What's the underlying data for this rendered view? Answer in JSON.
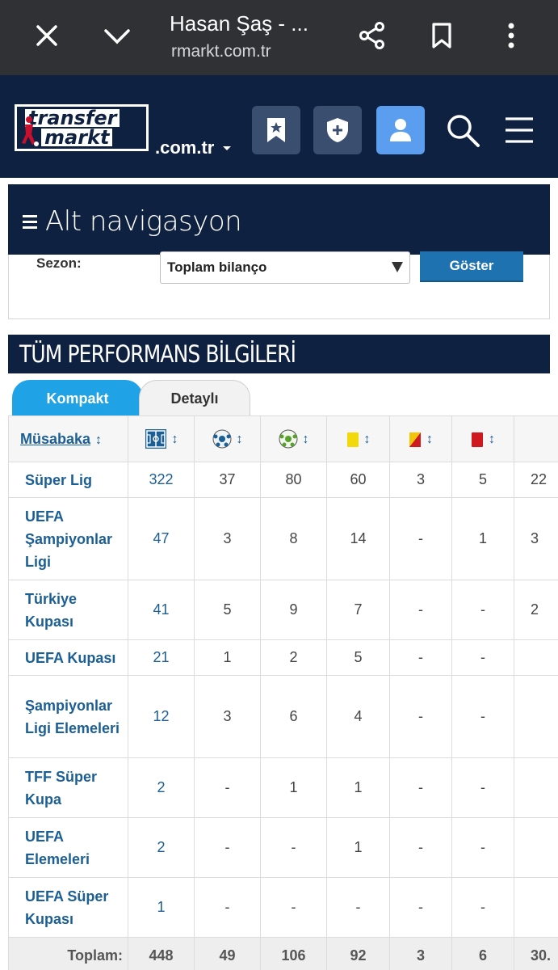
{
  "browser": {
    "title": "Hasan Şaş - ...",
    "url": "rmarkt.com.tr"
  },
  "site": {
    "logo_line1": "transfer",
    "logo_line2": "markt",
    "domain": ".com.tr"
  },
  "subnav": {
    "title": "Alt navigasyon",
    "season_label": "Sezon:",
    "season_value": "Toplam bilanço",
    "show_button": "Göster"
  },
  "performance": {
    "title": "TÜM PERFORMANS BİLGİLERİ",
    "tabs": [
      "Kompakt",
      "Detaylı"
    ],
    "header": {
      "competition": "Müsabaka",
      "sort_symbol": "↕"
    },
    "rows": [
      {
        "competition": "Süper Lig",
        "apps": "322",
        "goals": "37",
        "assists": "80",
        "yellow": "60",
        "second_yellow": "3",
        "red": "5",
        "minutes": "22"
      },
      {
        "competition": "UEFA Şampiyonlar Ligi",
        "apps": "47",
        "goals": "3",
        "assists": "8",
        "yellow": "14",
        "second_yellow": "-",
        "red": "1",
        "minutes": "3"
      },
      {
        "competition": "Türkiye Kupası",
        "apps": "41",
        "goals": "5",
        "assists": "9",
        "yellow": "7",
        "second_yellow": "-",
        "red": "-",
        "minutes": "2"
      },
      {
        "competition": "UEFA Kupası",
        "apps": "21",
        "goals": "1",
        "assists": "2",
        "yellow": "5",
        "second_yellow": "-",
        "red": "-",
        "minutes": ""
      },
      {
        "competition": "Şampiyonlar Ligi Elemeleri",
        "apps": "12",
        "goals": "3",
        "assists": "6",
        "yellow": "4",
        "second_yellow": "-",
        "red": "-",
        "minutes": ""
      },
      {
        "competition": "TFF Süper Kupa",
        "apps": "2",
        "goals": "-",
        "assists": "1",
        "yellow": "1",
        "second_yellow": "-",
        "red": "-",
        "minutes": ""
      },
      {
        "competition": "UEFA Elemeleri",
        "apps": "2",
        "goals": "-",
        "assists": "-",
        "yellow": "1",
        "second_yellow": "-",
        "red": "-",
        "minutes": ""
      },
      {
        "competition": "UEFA Süper Kupası",
        "apps": "1",
        "goals": "-",
        "assists": "-",
        "yellow": "-",
        "second_yellow": "-",
        "red": "-",
        "minutes": ""
      }
    ],
    "total": {
      "label": "Toplam:",
      "apps": "448",
      "goals": "49",
      "assists": "106",
      "yellow": "92",
      "second_yellow": "3",
      "red": "6",
      "minutes": "30."
    }
  },
  "colors": {
    "navy": "#0f2141",
    "link": "#1c5f95",
    "tab_active": "#1fa2e6",
    "button": "#1e72b0"
  }
}
